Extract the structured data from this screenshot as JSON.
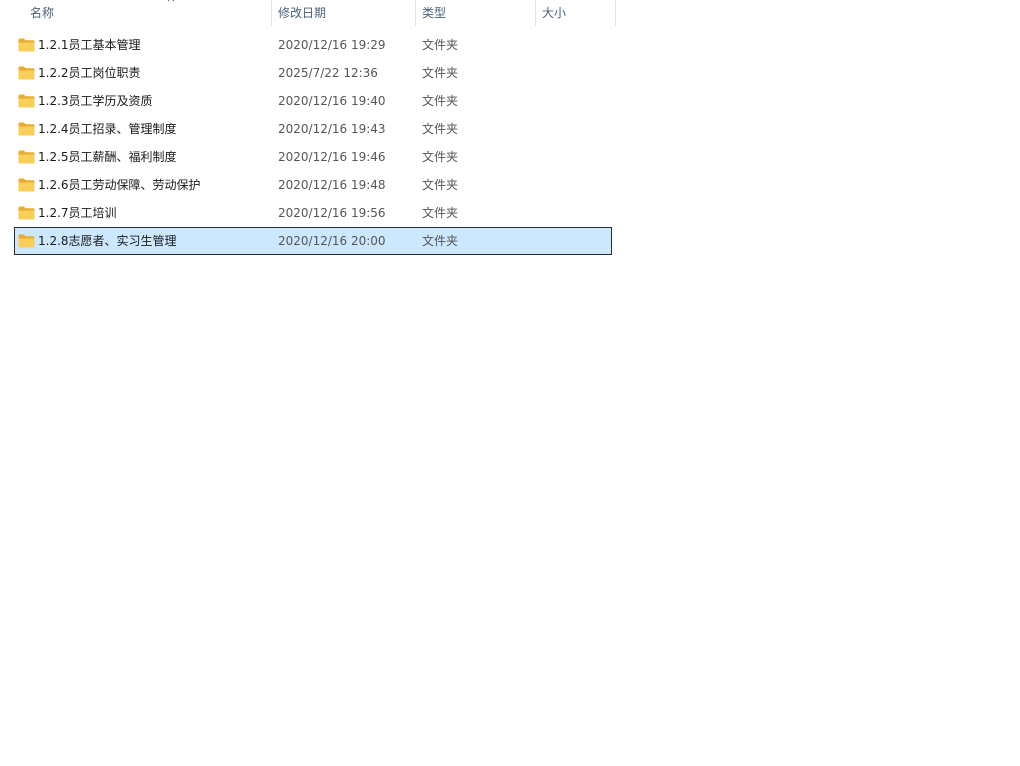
{
  "columns": {
    "name": "名称",
    "date": "修改日期",
    "type": "类型",
    "size": "大小"
  },
  "sort": {
    "column": "name",
    "direction": "ascending"
  },
  "rows": [
    {
      "name": "1.2.1员工基本管理",
      "date": "2020/12/16 19:29",
      "type": "文件夹",
      "size": ""
    },
    {
      "name": "1.2.2员工岗位职责",
      "date": "2025/7/22 12:36",
      "type": "文件夹",
      "size": ""
    },
    {
      "name": "1.2.3员工学历及资质",
      "date": "2020/12/16 19:40",
      "type": "文件夹",
      "size": ""
    },
    {
      "name": "1.2.4员工招录、管理制度",
      "date": "2020/12/16 19:43",
      "type": "文件夹",
      "size": ""
    },
    {
      "name": "1.2.5员工薪酬、福利制度",
      "date": "2020/12/16 19:46",
      "type": "文件夹",
      "size": ""
    },
    {
      "name": "1.2.6员工劳动保障、劳动保护",
      "date": "2020/12/16 19:48",
      "type": "文件夹",
      "size": ""
    },
    {
      "name": "1.2.7员工培训",
      "date": "2020/12/16 19:56",
      "type": "文件夹",
      "size": ""
    },
    {
      "name": "1.2.8志愿者、实习生管理",
      "date": "2020/12/16 20:00",
      "type": "文件夹",
      "size": "",
      "selected": true
    }
  ],
  "colors": {
    "header_text": "#4c607a",
    "selection_bg": "#cce8ff",
    "folder": "#f4c34a"
  },
  "icons": {
    "row": "folder-icon",
    "sort": "sort-up-arrow-icon"
  }
}
